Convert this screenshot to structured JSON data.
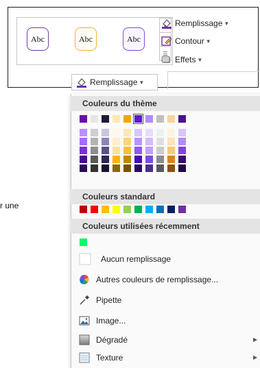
{
  "side_text": "r une",
  "ribbon": {
    "style_label": "Abc",
    "remplissage": "Remplissage",
    "contour": "Contour",
    "effets": "Effets"
  },
  "trigger_label": "Remplissage",
  "sections": {
    "theme": "Couleurs du thème",
    "standard": "Couleurs standard",
    "recent": "Couleurs utilisées récemment"
  },
  "theme_colors": {
    "columns": [
      [
        "#6a0dad",
        "#bf8fff",
        "#a56bff",
        "#7a30e0",
        "#4b0b8c",
        "#2c0855"
      ],
      [
        "#e6e6e6",
        "#cfcfcf",
        "#b3b3b3",
        "#8f8f8f",
        "#5a5a5a",
        "#333333"
      ],
      [
        "#1f1a3a",
        "#c9c6e0",
        "#8c86b5",
        "#5a5289",
        "#2f2850",
        "#15122a"
      ],
      [
        "#ffe9b3",
        "#fff8e8",
        "#ffefcc",
        "#ffe0a0",
        "#f5b800",
        "#8c6a00"
      ],
      [
        "#f0a800",
        "#fde7b3",
        "#fbd478",
        "#f6be3b",
        "#c48500",
        "#7a5200"
      ],
      [
        "#5b18d6",
        "#d8c6ff",
        "#b596ff",
        "#8c5bf0",
        "#4510a8",
        "#2a0a66"
      ],
      [
        "#b38cff",
        "#e8dbff",
        "#d4bcff",
        "#c0a0ff",
        "#7a4fd9",
        "#4a2e8c"
      ],
      [
        "#c0c0c0",
        "#f0f0f0",
        "#e0e0e0",
        "#cccccc",
        "#8c8c8c",
        "#5a5a5a"
      ],
      [
        "#f8d49a",
        "#fff2dd",
        "#fde3b8",
        "#f9c97a",
        "#d4891a",
        "#8a540e"
      ],
      [
        "#4a148c",
        "#dac4ff",
        "#b18bff",
        "#7f45e0",
        "#380d6e",
        "#220845"
      ]
    ],
    "selected": "column-5-top"
  },
  "standard_colors": [
    "#c00000",
    "#ff0000",
    "#ffc000",
    "#ffff00",
    "#92d050",
    "#00b050",
    "#00b0f0",
    "#0070c0",
    "#002060",
    "#7030a0"
  ],
  "recent_colors": [
    "#00ff66"
  ],
  "menu": {
    "no_fill": "Aucun remplissage",
    "more_colors": "Autres couleurs de remplissage...",
    "eyedropper": "Pipette",
    "image": "Image...",
    "gradient": "Dégradé",
    "texture": "Texture"
  }
}
